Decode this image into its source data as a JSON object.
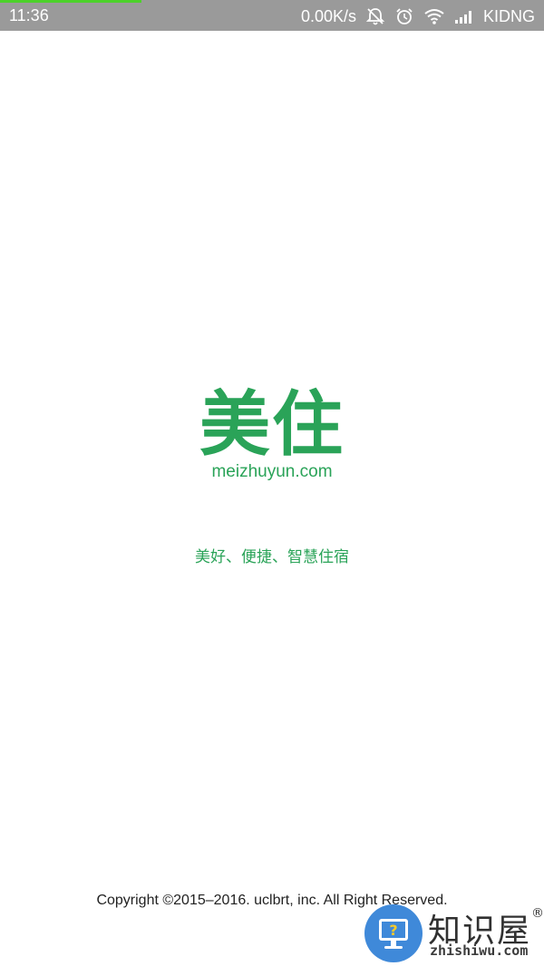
{
  "status_bar": {
    "time": "11:36",
    "network_speed": "0.00K/s",
    "carrier": "KIDNG",
    "icons": [
      "mute-icon",
      "alarm-icon",
      "wifi-icon",
      "signal-icon"
    ],
    "progress": 0.26,
    "bg_color": "#9a9a9a",
    "progress_color": "#4cd12a"
  },
  "brand": {
    "logo_text": "美住",
    "domain": "meizhuyun.com",
    "color": "#2aa358"
  },
  "tagline": "美好、便捷、智慧住宿",
  "footer": {
    "copyright": "Copyright ©2015–2016. uclbrt, inc. All Right Reserved."
  },
  "watermark": {
    "title": "知识屋",
    "registered": "®",
    "url": "zhishiwu.com",
    "badge_color": "#2f7fd6"
  }
}
